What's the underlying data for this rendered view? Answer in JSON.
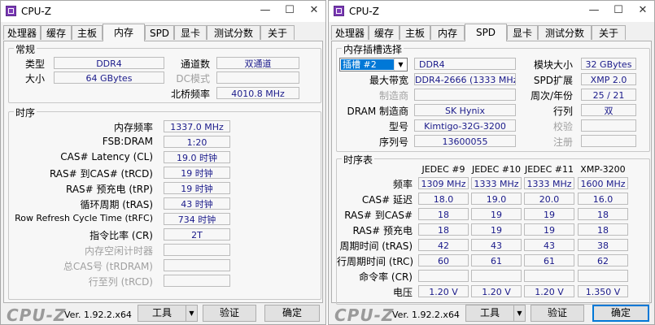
{
  "left": {
    "title": "CPU-Z",
    "controls": {
      "min": "—",
      "max": "☐",
      "close": "✕"
    },
    "tabs": [
      "处理器",
      "缓存",
      "主板",
      "内存",
      "SPD",
      "显卡",
      "测试分数",
      "关于"
    ],
    "active_tab": "内存",
    "general": {
      "title": "常规",
      "type_label": "类型",
      "type_value": "DDR4",
      "size_label": "大小",
      "size_value": "64 GBytes",
      "channels_label": "通道数",
      "channels_value": "双通道",
      "dc_mode_label": "DC模式",
      "dc_mode_value": "",
      "nb_freq_label": "北桥频率",
      "nb_freq_value": "4010.8 MHz"
    },
    "timings": {
      "title": "时序",
      "rows": [
        {
          "label": "内存频率",
          "value": "1337.0 MHz",
          "disabled": false
        },
        {
          "label": "FSB:DRAM",
          "value": "1:20",
          "disabled": false
        },
        {
          "label": "CAS# Latency (CL)",
          "value": "19.0 时钟",
          "disabled": false
        },
        {
          "label": "RAS# 到CAS# (tRCD)",
          "value": "19 时钟",
          "disabled": false
        },
        {
          "label": "RAS# 预充电 (tRP)",
          "value": "19 时钟",
          "disabled": false
        },
        {
          "label": "循环周期 (tRAS)",
          "value": "43 时钟",
          "disabled": false
        },
        {
          "label": "Row Refresh Cycle Time (tRFC)",
          "value": "734 时钟",
          "disabled": false
        },
        {
          "label": "指令比率 (CR)",
          "value": "2T",
          "disabled": false
        },
        {
          "label": "内存空闲计时器",
          "value": "",
          "disabled": true
        },
        {
          "label": "总CAS号 (tRDRAM)",
          "value": "",
          "disabled": true
        },
        {
          "label": "行至列 (tRCD)",
          "value": "",
          "disabled": true
        }
      ]
    },
    "footer": {
      "logo": "CPU-Z",
      "version": "Ver. 1.92.2.x64",
      "tools": "工具",
      "validate": "验证",
      "ok": "确定",
      "dd": "▼"
    }
  },
  "right": {
    "title": "CPU-Z",
    "controls": {
      "min": "—",
      "max": "☐",
      "close": "✕"
    },
    "tabs": [
      "处理器",
      "缓存",
      "主板",
      "内存",
      "SPD",
      "显卡",
      "测试分数",
      "关于"
    ],
    "active_tab": "SPD",
    "slot": {
      "title": "内存插槽选择",
      "selected": "插槽 #2",
      "arrow": "▼",
      "type_value": "DDR4",
      "module_size_label": "模块大小",
      "module_size_value": "32 GBytes",
      "max_bw_label": "最大带宽",
      "max_bw_value": "DDR4-2666 (1333 MHz)",
      "spd_ext_label": "SPD扩展",
      "spd_ext_value": "XMP 2.0",
      "manufacturer_label": "制造商",
      "manufacturer_value": "",
      "week_year_label": "周次/年份",
      "week_year_value": "25 / 21",
      "dram_mfr_label": "DRAM 制造商",
      "dram_mfr_value": "SK Hynix",
      "ranks_label": "行列",
      "ranks_value": "双",
      "part_label": "型号",
      "part_value": "Kimtigo-32G-3200",
      "checksum_label": "校验",
      "checksum_value": "",
      "serial_label": "序列号",
      "serial_value": "13600055",
      "reg_label": "注册",
      "reg_value": ""
    },
    "timing_table": {
      "title": "时序表",
      "columns": [
        "JEDEC #9",
        "JEDEC #10",
        "JEDEC #11",
        "XMP-3200"
      ],
      "rows": [
        {
          "label": "频率",
          "values": [
            "1309 MHz",
            "1333 MHz",
            "1333 MHz",
            "1600 MHz"
          ]
        },
        {
          "label": "CAS# 延迟",
          "values": [
            "18.0",
            "19.0",
            "20.0",
            "16.0"
          ]
        },
        {
          "label": "RAS# 到CAS#",
          "values": [
            "18",
            "19",
            "19",
            "18"
          ]
        },
        {
          "label": "RAS# 预充电",
          "values": [
            "18",
            "19",
            "19",
            "18"
          ]
        },
        {
          "label": "周期时间 (tRAS)",
          "values": [
            "42",
            "43",
            "43",
            "38"
          ]
        },
        {
          "label": "行周期时间 (tRC)",
          "values": [
            "60",
            "61",
            "61",
            "62"
          ]
        },
        {
          "label": "命令率 (CR)",
          "values": [
            "",
            "",
            "",
            ""
          ]
        },
        {
          "label": "电压",
          "values": [
            "1.20 V",
            "1.20 V",
            "1.20 V",
            "1.350 V"
          ]
        }
      ]
    },
    "footer": {
      "logo": "CPU-Z",
      "version": "Ver. 1.92.2.x64",
      "tools": "工具",
      "validate": "验证",
      "ok": "确定",
      "dd": "▼"
    }
  }
}
